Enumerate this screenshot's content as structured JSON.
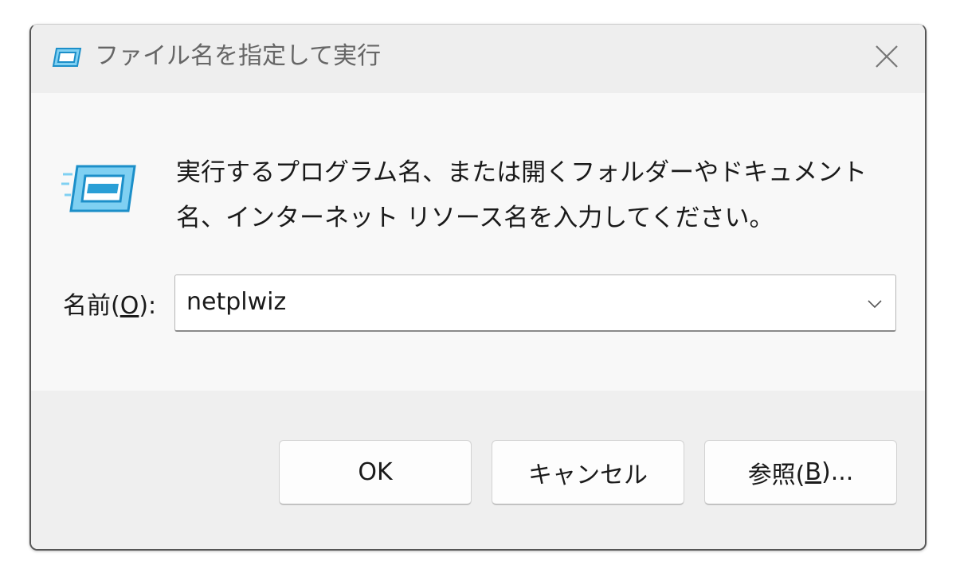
{
  "window": {
    "title": "ファイル名を指定して実行",
    "title_icon": "run-icon",
    "close_icon": "close-icon"
  },
  "content": {
    "icon": "run-icon",
    "description": "実行するプログラム名、または開くフォルダーやドキュメント名、インターネット リソース名を入力してください。"
  },
  "name_field": {
    "label_prefix": "名前(",
    "label_accel": "O",
    "label_suffix": "):",
    "value": "netplwiz",
    "dropdown_icon": "chevron-down-icon"
  },
  "buttons": {
    "ok_label": "OK",
    "cancel_label": "キャンセル",
    "browse_prefix": "参照(",
    "browse_accel": "B",
    "browse_suffix": ")..."
  },
  "colors": {
    "icon_blue": "#2a9fd6",
    "icon_light": "#7fd0f2",
    "dialog_bg": "#f0f0f0",
    "content_bg": "#f8f8f8"
  }
}
